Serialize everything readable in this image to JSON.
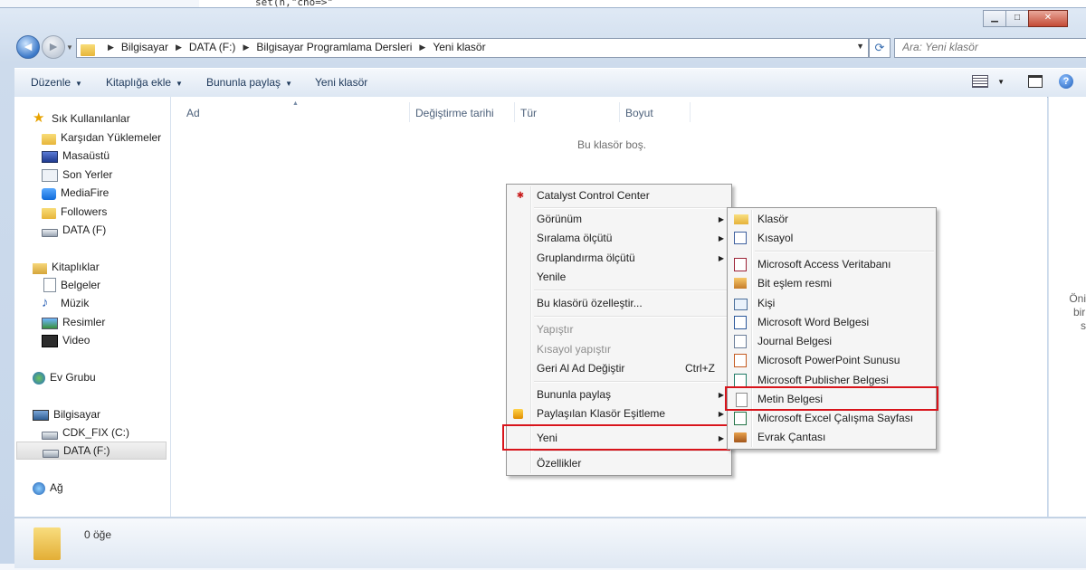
{
  "background": {
    "code_snippet": "set(n,\"cho=>\""
  },
  "window_controls": {
    "minimize": "▁",
    "maximize": "□",
    "close": "✕"
  },
  "nav": {
    "back_icon": "back-arrow-icon",
    "forward_icon": "forward-arrow-icon"
  },
  "address_bar": {
    "crumbs": [
      "Bilgisayar",
      "DATA (F:)",
      "Bilgisayar Programlama Dersleri",
      "Yeni klasör"
    ]
  },
  "search": {
    "placeholder": "Ara: Yeni klasör"
  },
  "toolbar": {
    "organize": "Düzenle",
    "include_in_library": "Kitaplığa ekle",
    "share_with": "Bununla paylaş",
    "new_folder": "Yeni klasör"
  },
  "sidebar": {
    "favorites": "Sık Kullanılanlar",
    "favorite_items": [
      "Karşıdan Yüklemeler",
      "Masaüstü",
      "Son Yerler",
      "MediaFire",
      "Followers",
      "DATA (F)"
    ],
    "libraries": "Kitaplıklar",
    "library_items": [
      "Belgeler",
      "Müzik",
      "Resimler",
      "Video"
    ],
    "homegroup": "Ev Grubu",
    "computer": "Bilgisayar",
    "computer_items": [
      "CDK_FIX (C:)",
      "DATA (F:)"
    ],
    "network": "Ağ"
  },
  "columns": [
    "Ad",
    "Değiştirme tarihi",
    "Tür",
    "Boyut"
  ],
  "empty_message": "Bu klasör boş.",
  "preview_text": [
    "Önizlen",
    "bir dos",
    "seçin"
  ],
  "details": {
    "count": "0 öğe"
  },
  "context_menu": {
    "catalyst": "Catalyst Control Center",
    "view": "Görünüm",
    "sort_by": "Sıralama ölçütü",
    "group_by": "Gruplandırma ölçütü",
    "refresh": "Yenile",
    "customize": "Bu klasörü özelleştir...",
    "paste": "Yapıştır",
    "paste_shortcut": "Kısayol yapıştır",
    "undo_rename": "Geri Al Ad Değiştir",
    "undo_shortcut": "Ctrl+Z",
    "share_with": "Bununla paylaş",
    "shared_sync": "Paylaşılan Klasör Eşitleme",
    "new": "Yeni",
    "properties": "Özellikler"
  },
  "new_submenu": {
    "folder": "Klasör",
    "shortcut": "Kısayol",
    "access": "Microsoft Access Veritabanı",
    "bitmap": "Bit eşlem resmi",
    "contact": "Kişi",
    "word": "Microsoft Word Belgesi",
    "journal": "Journal Belgesi",
    "powerpoint": "Microsoft PowerPoint Sunusu",
    "publisher": "Microsoft Publisher Belgesi",
    "text": "Metin Belgesi",
    "excel": "Microsoft Excel Çalışma Sayfası",
    "briefcase": "Evrak Çantası"
  },
  "colors": {
    "highlight": "#d8141b",
    "accent": "#3a78c8"
  }
}
